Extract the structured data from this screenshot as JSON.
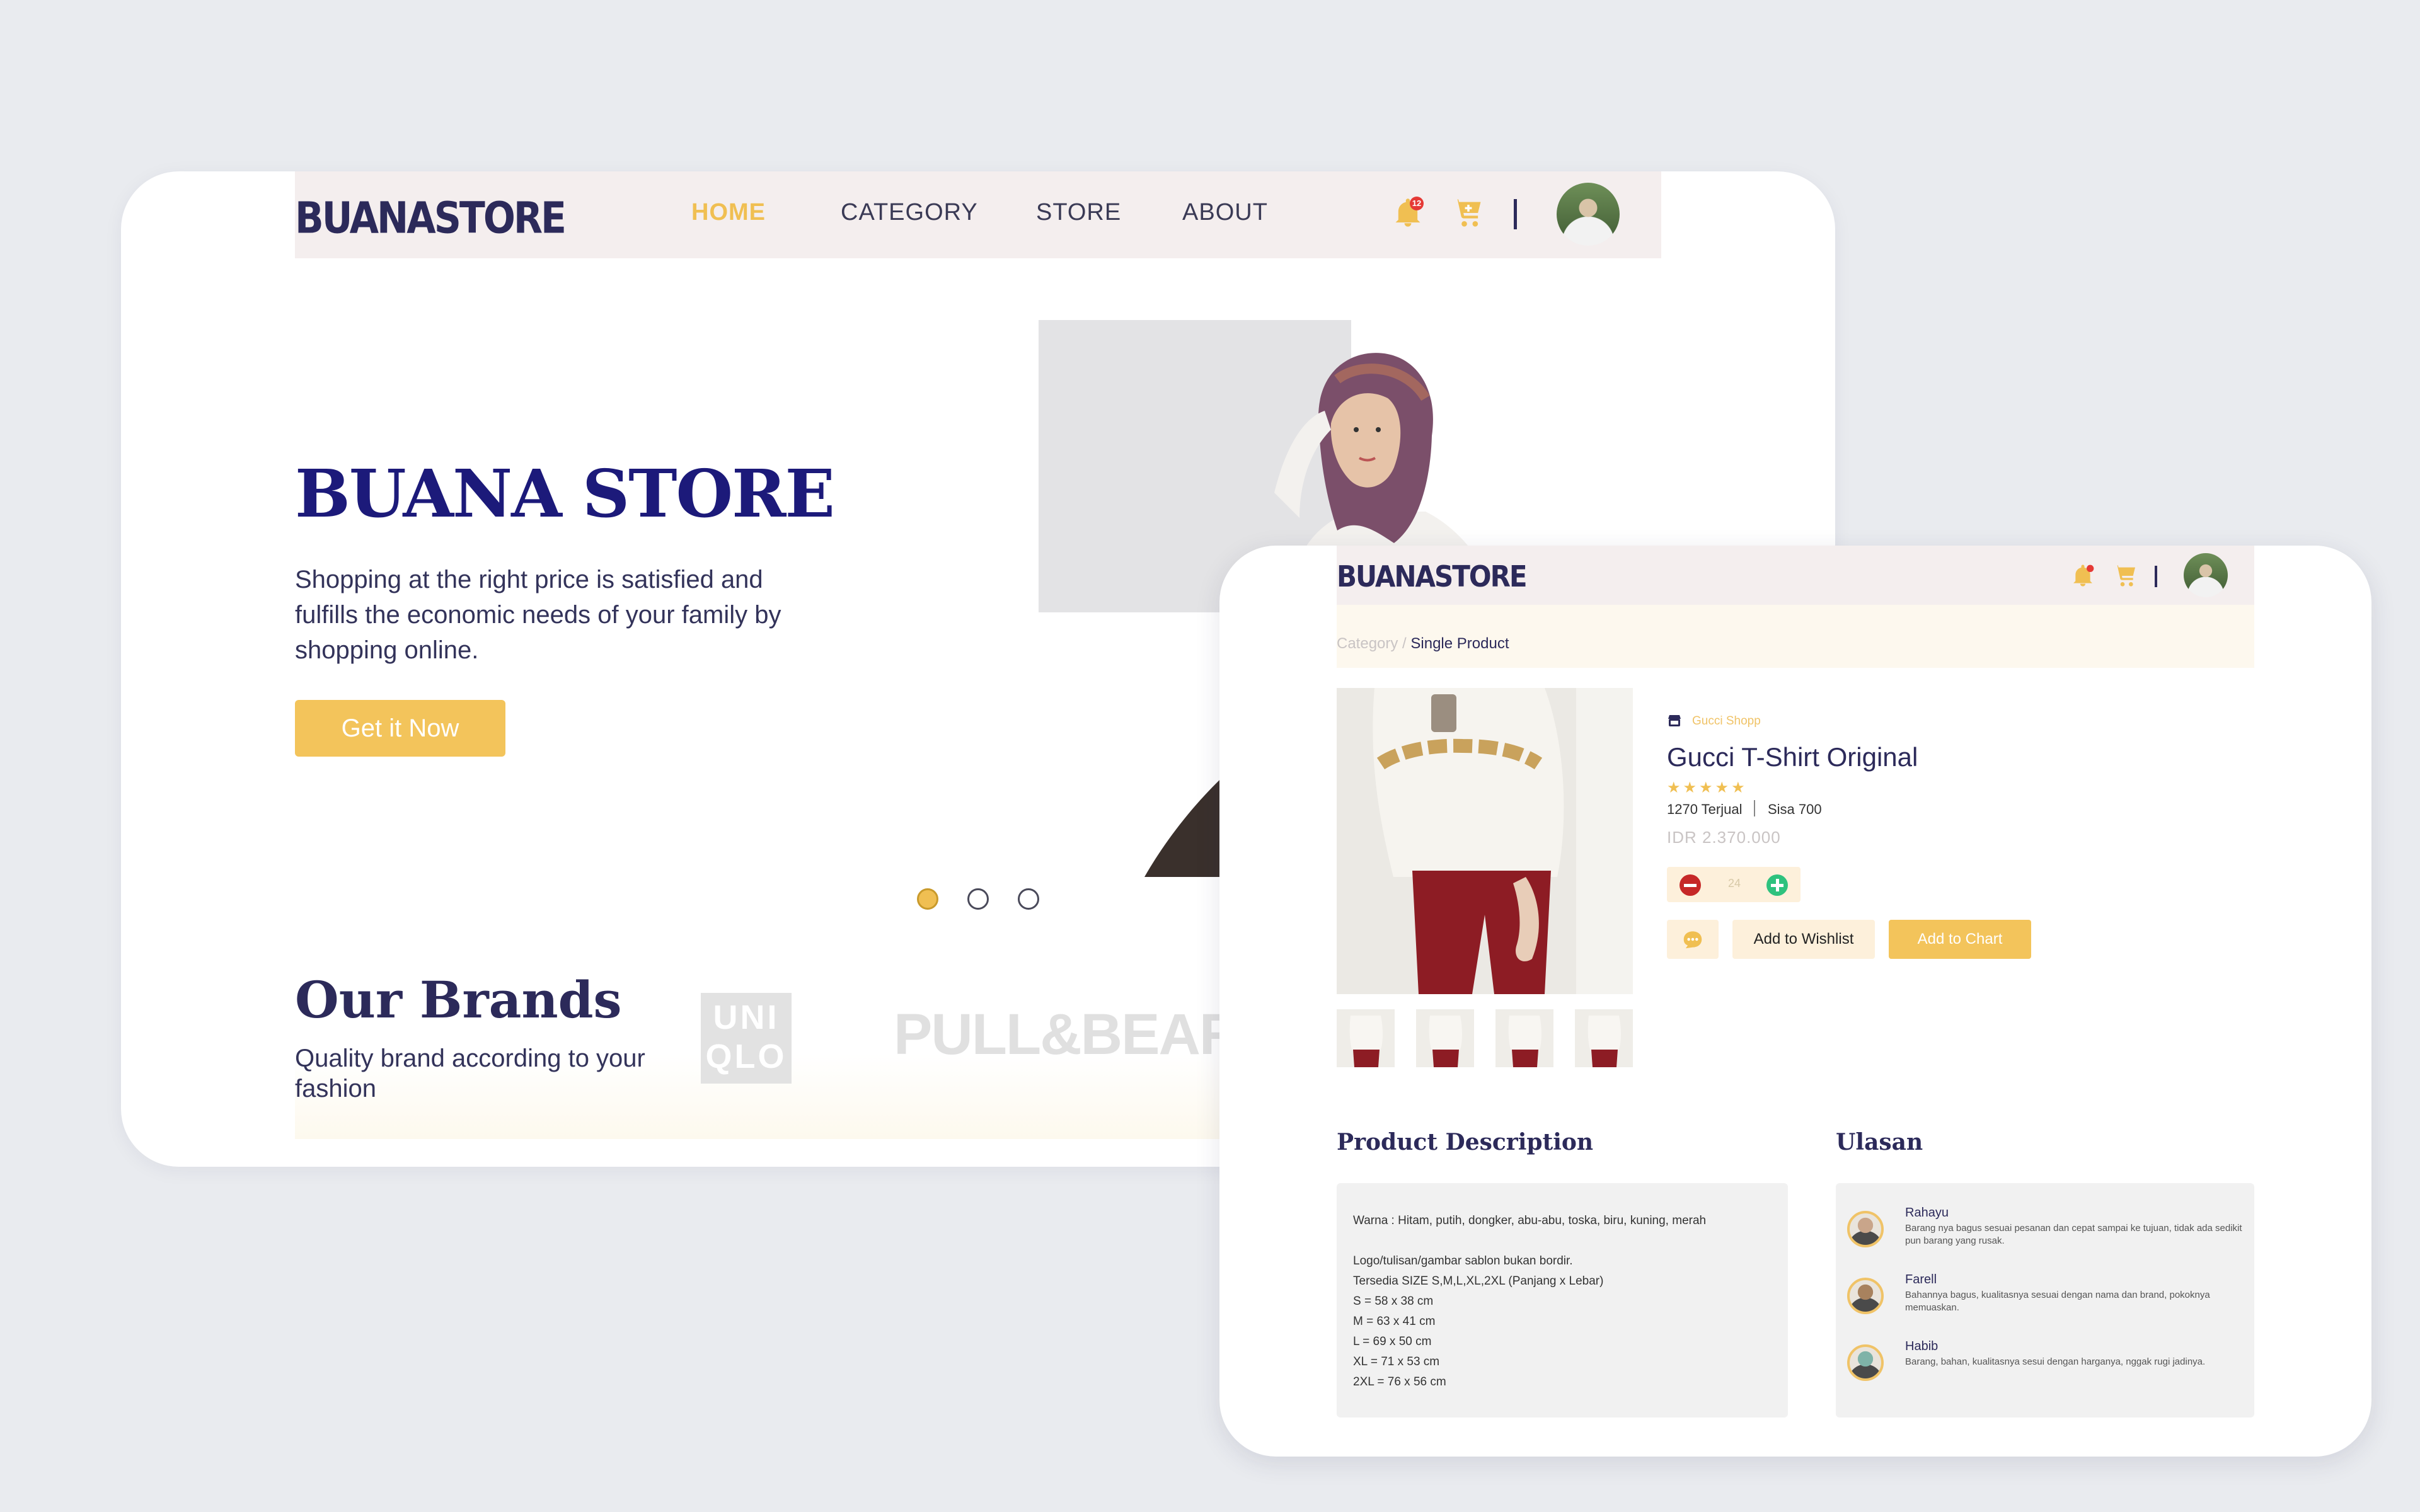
{
  "home": {
    "logo": "BUANASTORE",
    "nav": {
      "home": "HOME",
      "category": "CATEGORY",
      "store": "STORE",
      "about": "ABOUT"
    },
    "notification_count": "12",
    "hero": {
      "title": "BUANA STORE",
      "subtitle": "Shopping at the right price is satisfied and fulfills the economic needs of your family by shopping online.",
      "cta": "Get it Now"
    },
    "carousel": {
      "total": 3,
      "active": 1
    },
    "brands": {
      "title": "Our Brands",
      "subtitle": "Quality brand according to your fashion",
      "uniqlo": "UNI QLO",
      "pullbear": "PULL&BEAR"
    }
  },
  "product": {
    "logo": "BUANASTORE",
    "breadcrumb": {
      "parent": "Category /",
      "current": "Single Product"
    },
    "shop_name": "Gucci Shopp",
    "title": "Gucci T-Shirt Original",
    "rating_stars": "★★★★★",
    "rating": 4.5,
    "sold": "1270 Terjual",
    "stock": "Sisa 700",
    "price": "IDR 2.370.000",
    "quantity": "24",
    "wishlist_label": "Add to Wishlist",
    "cart_label": "Add to Chart",
    "description_title": "Product Description",
    "description_lines": [
      "Warna : Hitam, putih, dongker, abu-abu, toska, biru, kuning, merah",
      "",
      "Logo/tulisan/gambar sablon bukan bordir.",
      "Tersedia SIZE S,M,L,XL,2XL (Panjang x Lebar)",
      "S = 58 x 38 cm",
      "M = 63 x 41 cm",
      "L = 69 x 50 cm",
      "XL = 71 x 53 cm",
      "2XL = 76 x 56 cm"
    ],
    "reviews_title": "Ulasan",
    "reviews": [
      {
        "name": "Rahayu",
        "text": "Barang nya bagus sesuai pesanan dan cepat sampai ke tujuan, tidak ada sedikit pun barang yang rusak."
      },
      {
        "name": "Farell",
        "text": "Bahannya bagus, kualitasnya sesuai dengan nama dan brand, pokoknya memuaskan."
      },
      {
        "name": "Habib",
        "text": "Barang, bahan, kualitasnya sesui dengan harganya, nggak rugi jadinya."
      }
    ]
  },
  "colors": {
    "navy": "#2c2a5a",
    "accent": "#f3c45b",
    "nav_bg": "#f4eeee"
  },
  "icons": [
    "bell-icon",
    "cart-icon",
    "chat-icon",
    "store-icon",
    "minus-icon",
    "plus-icon"
  ]
}
